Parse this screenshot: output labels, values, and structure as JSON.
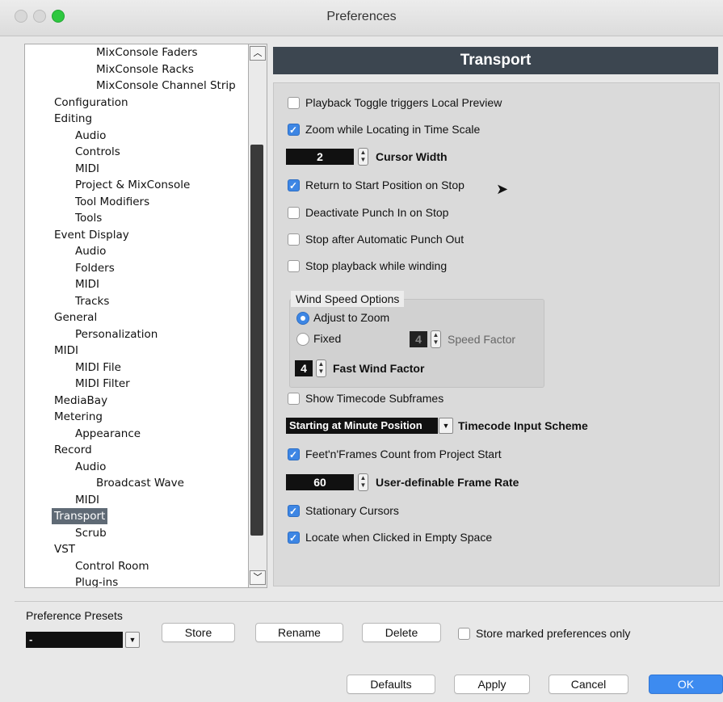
{
  "window": {
    "title": "Preferences"
  },
  "tree": [
    {
      "label": "MixConsole Faders",
      "indent": 3
    },
    {
      "label": "MixConsole Racks",
      "indent": 3
    },
    {
      "label": "MixConsole Channel Strip",
      "indent": 3
    },
    {
      "label": "Configuration",
      "indent": 1
    },
    {
      "label": "Editing",
      "indent": 1
    },
    {
      "label": "Audio",
      "indent": 2
    },
    {
      "label": "Controls",
      "indent": 2
    },
    {
      "label": "MIDI",
      "indent": 2
    },
    {
      "label": "Project & MixConsole",
      "indent": 2
    },
    {
      "label": "Tool Modifiers",
      "indent": 2
    },
    {
      "label": "Tools",
      "indent": 2
    },
    {
      "label": "Event Display",
      "indent": 1
    },
    {
      "label": "Audio",
      "indent": 2
    },
    {
      "label": "Folders",
      "indent": 2
    },
    {
      "label": "MIDI",
      "indent": 2
    },
    {
      "label": "Tracks",
      "indent": 2
    },
    {
      "label": "General",
      "indent": 1
    },
    {
      "label": "Personalization",
      "indent": 2
    },
    {
      "label": "MIDI",
      "indent": 1
    },
    {
      "label": "MIDI File",
      "indent": 2
    },
    {
      "label": "MIDI Filter",
      "indent": 2
    },
    {
      "label": "MediaBay",
      "indent": 1
    },
    {
      "label": "Metering",
      "indent": 1
    },
    {
      "label": "Appearance",
      "indent": 2
    },
    {
      "label": "Record",
      "indent": 1
    },
    {
      "label": "Audio",
      "indent": 2
    },
    {
      "label": "Broadcast Wave",
      "indent": 3
    },
    {
      "label": "MIDI",
      "indent": 2
    },
    {
      "label": "Transport",
      "indent": 1,
      "selected": true
    },
    {
      "label": "Scrub",
      "indent": 2
    },
    {
      "label": "VST",
      "indent": 1
    },
    {
      "label": "Control Room",
      "indent": 2
    },
    {
      "label": "Plug-ins",
      "indent": 2
    }
  ],
  "panel": {
    "title": "Transport",
    "playback_toggle": {
      "label": "Playback Toggle triggers Local Preview",
      "checked": false
    },
    "zoom_locating": {
      "label": "Zoom while Locating in Time Scale",
      "checked": true
    },
    "cursor_width": {
      "value": "2",
      "label": "Cursor Width"
    },
    "return_start": {
      "label": "Return to Start Position on Stop",
      "checked": true
    },
    "deactivate_punch": {
      "label": "Deactivate Punch In on Stop",
      "checked": false
    },
    "stop_punch_out": {
      "label": "Stop after Automatic Punch Out",
      "checked": false
    },
    "stop_winding": {
      "label": "Stop playback while winding",
      "checked": false
    },
    "wind": {
      "title": "Wind Speed Options",
      "adjust_zoom": {
        "label": "Adjust to Zoom",
        "selected": true
      },
      "fixed": {
        "label": "Fixed",
        "selected": false
      },
      "speed_factor": {
        "value": "4",
        "label": "Speed Factor"
      },
      "fast_wind": {
        "value": "4",
        "label": "Fast Wind Factor"
      }
    },
    "timecode_subframes": {
      "label": "Show Timecode Subframes",
      "checked": false
    },
    "timecode_scheme": {
      "value": "Starting at Minute Position",
      "label": "Timecode Input Scheme"
    },
    "feet_frames": {
      "label": "Feet'n'Frames Count from Project Start",
      "checked": true
    },
    "frame_rate": {
      "value": "60",
      "label": "User-definable Frame Rate"
    },
    "stationary": {
      "label": "Stationary Cursors",
      "checked": true
    },
    "locate_click": {
      "label": "Locate when Clicked in Empty Space",
      "checked": true
    }
  },
  "presets": {
    "label": "Preference Presets",
    "value": "-",
    "store": "Store",
    "rename": "Rename",
    "delete": "Delete",
    "store_marked": {
      "label": "Store marked preferences only",
      "checked": false
    }
  },
  "footer": {
    "defaults": "Defaults",
    "apply": "Apply",
    "cancel": "Cancel",
    "ok": "OK"
  }
}
